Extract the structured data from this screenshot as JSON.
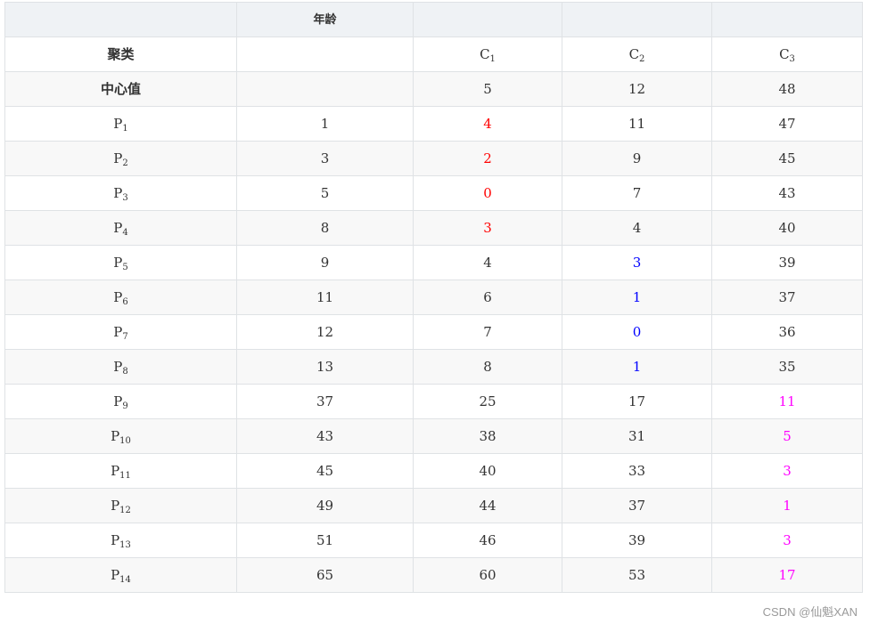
{
  "header": {
    "cells": [
      "",
      "年龄",
      "",
      "",
      ""
    ]
  },
  "cluster_row": {
    "label": "聚类",
    "age": "",
    "clusters": [
      {
        "letter": "C",
        "sub": "1"
      },
      {
        "letter": "C",
        "sub": "2"
      },
      {
        "letter": "C",
        "sub": "3"
      }
    ]
  },
  "center_row": {
    "label": "中心值",
    "age": "",
    "values": [
      "5",
      "12",
      "48"
    ]
  },
  "points": [
    {
      "letter": "P",
      "sub": "1",
      "age": "1",
      "d": [
        "4",
        "11",
        "47"
      ],
      "hl": 0
    },
    {
      "letter": "P",
      "sub": "2",
      "age": "3",
      "d": [
        "2",
        "9",
        "45"
      ],
      "hl": 0
    },
    {
      "letter": "P",
      "sub": "3",
      "age": "5",
      "d": [
        "0",
        "7",
        "43"
      ],
      "hl": 0
    },
    {
      "letter": "P",
      "sub": "4",
      "age": "8",
      "d": [
        "3",
        "4",
        "40"
      ],
      "hl": 0
    },
    {
      "letter": "P",
      "sub": "5",
      "age": "9",
      "d": [
        "4",
        "3",
        "39"
      ],
      "hl": 1
    },
    {
      "letter": "P",
      "sub": "6",
      "age": "11",
      "d": [
        "6",
        "1",
        "37"
      ],
      "hl": 1
    },
    {
      "letter": "P",
      "sub": "7",
      "age": "12",
      "d": [
        "7",
        "0",
        "36"
      ],
      "hl": 1
    },
    {
      "letter": "P",
      "sub": "8",
      "age": "13",
      "d": [
        "8",
        "1",
        "35"
      ],
      "hl": 1
    },
    {
      "letter": "P",
      "sub": "9",
      "age": "37",
      "d": [
        "25",
        "17",
        "11"
      ],
      "hl": 2
    },
    {
      "letter": "P",
      "sub": "10",
      "age": "43",
      "d": [
        "38",
        "31",
        "5"
      ],
      "hl": 2
    },
    {
      "letter": "P",
      "sub": "11",
      "age": "45",
      "d": [
        "40",
        "33",
        "3"
      ],
      "hl": 2
    },
    {
      "letter": "P",
      "sub": "12",
      "age": "49",
      "d": [
        "44",
        "37",
        "1"
      ],
      "hl": 2
    },
    {
      "letter": "P",
      "sub": "13",
      "age": "51",
      "d": [
        "46",
        "39",
        "3"
      ],
      "hl": 2
    },
    {
      "letter": "P",
      "sub": "14",
      "age": "65",
      "d": [
        "60",
        "53",
        "17"
      ],
      "hl": 2
    }
  ],
  "highlight_colors": [
    "#ff0000",
    "#0000ff",
    "#ff00ff"
  ],
  "watermark": "CSDN @仙魁XAN"
}
